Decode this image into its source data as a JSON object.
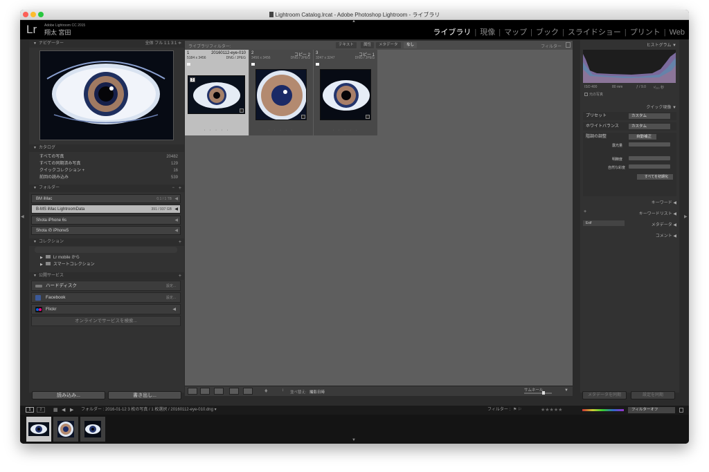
{
  "window": {
    "title": "Lightroom Catalog.lrcat - Adobe Photoshop Lightroom - ライブラリ"
  },
  "identity": {
    "logo": "Lr",
    "app_name": "Adobe Lightroom CC 2015",
    "user": "翔太 宮田"
  },
  "modules": [
    "ライブラリ",
    "現像",
    "マップ",
    "ブック",
    "スライドショー",
    "プリント",
    "Web"
  ],
  "left_panel": {
    "navigator": {
      "label": "ナビゲーター",
      "options": "全体 フル 1:1 3:1 ≑"
    },
    "catalog": {
      "label": "カタログ",
      "items": [
        {
          "label": "すべての写真",
          "count": "20482"
        },
        {
          "label": "すべての同期済み写真",
          "count": "129"
        },
        {
          "label": "クイックコレクション +",
          "count": "16"
        },
        {
          "label": "前回の読み込み",
          "count": "539"
        }
      ]
    },
    "folders": {
      "label": "フォルダー",
      "volumes": [
        {
          "label": "BM iMac",
          "count": "0.1 / 1 TB"
        },
        {
          "label": "B-MS iMac LightroomData",
          "count": "391 / 937 GB"
        },
        {
          "label": "Shota iPhone 6s",
          "count": ""
        },
        {
          "label": "Shota の iPhone5",
          "count": ""
        }
      ]
    },
    "collections": {
      "label": "コレクション",
      "items": [
        "Lr mobile から",
        "スマートコレクション"
      ]
    },
    "publish": {
      "label": "公開サービス",
      "services": [
        {
          "label": "ハードディスク",
          "setup": "設定..."
        },
        {
          "label": "Facebook",
          "setup": "設定..."
        },
        {
          "label": "Flickr",
          "setup": ""
        }
      ],
      "find_more": "オンラインでサービスを検索..."
    },
    "import_button": "読み込み...",
    "export_button": "書き出し..."
  },
  "filter_bar": {
    "label": "ライブラリフィルター:",
    "tabs": [
      "テキスト",
      "属性",
      "メタデータ",
      "なし"
    ],
    "active_tab": "なし",
    "filter_label": "フィルター"
  },
  "grid": {
    "cells": [
      {
        "index": "1",
        "name": "20160112-eye-010",
        "dims": "5184 x 3456",
        "format": "DNG / JPEG"
      },
      {
        "index": "2",
        "name": "コピー 2",
        "dims": "3456 x 3456",
        "format": "DNG / JPEG"
      },
      {
        "index": "3",
        "name": "コピー 1",
        "dims": "3247 x 3247",
        "format": "DNG / JPEG"
      }
    ]
  },
  "toolbar": {
    "sort_label": "並べ替え:",
    "sort_value": "撮影日時",
    "thumb_label": "サムネール"
  },
  "right_panel": {
    "histogram": {
      "label": "ヒストグラム",
      "iso": "ISO 400",
      "focal": "80 mm",
      "aperture": "ƒ / 9.0",
      "shutter": "¹⁄₃₂₀ 秒",
      "original": "元の写真"
    },
    "quick_develop": {
      "label": "クイック現像",
      "preset_label": "プリセット",
      "preset_value": "カスタム",
      "wb_label": "ホワイトバランス",
      "wb_value": "カスタム",
      "tone_label": "階調の調整",
      "auto_label": "自動補正",
      "exposure_label": "露光量",
      "clarity_label": "明瞭度",
      "vibrance_label": "自然な彩度",
      "reset_label": "すべてを初期化"
    },
    "keywording": "キーワード",
    "keyword_list": "キーワードリスト",
    "metadata": {
      "label": "メタデータ",
      "preset": "Exif"
    },
    "comments": "コメント",
    "sync_metadata": "メタデータを同期",
    "sync_settings": "設定を同期"
  },
  "filmstrip": {
    "view_1": "1",
    "view_2": "2",
    "path": "フォルダー : 2016-01-12   3 枚の写真 / 1 枚選択 / 20160112-eye-010.dng ▾",
    "filter_label": "フィルター :",
    "filter_value": "フィルターオフ"
  }
}
